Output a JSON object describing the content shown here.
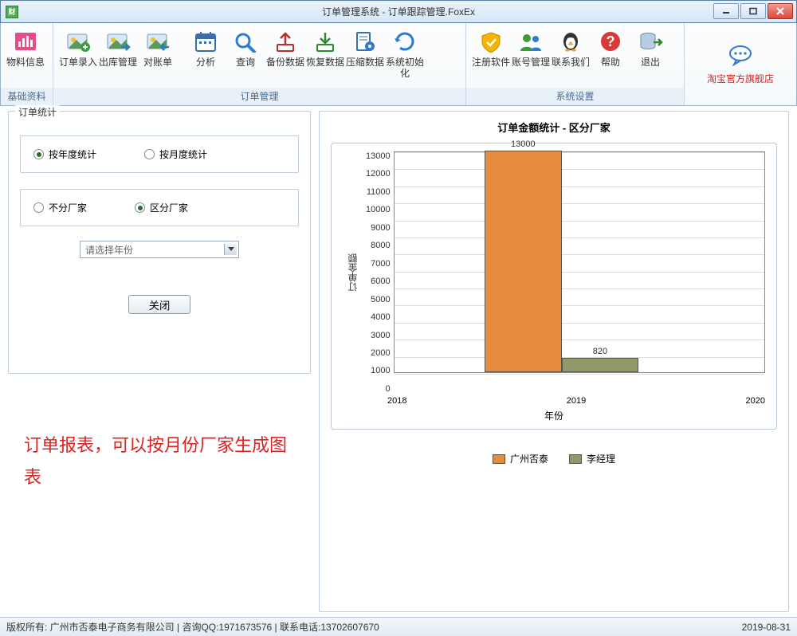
{
  "window": {
    "title": "订单管理系统 - 订单跟踪管理.FoxEx"
  },
  "ribbon": {
    "groups": [
      {
        "label": "基础资料",
        "items": [
          {
            "name": "material-info",
            "label": "物料信息",
            "icon": "chart-pink"
          },
          {
            "name": "order-entry",
            "label": "订单录入",
            "icon": "photo-plus"
          },
          {
            "name": "outbound-mgmt",
            "label": "出库管理",
            "icon": "photo-right"
          },
          {
            "name": "reconcile",
            "label": "对账单",
            "icon": "photo-left"
          }
        ]
      },
      {
        "label": "订单管理",
        "items": [
          {
            "name": "analysis",
            "label": "分析",
            "icon": "calendar"
          },
          {
            "name": "query",
            "label": "查询",
            "icon": "magnifier"
          },
          {
            "name": "backup",
            "label": "备份数据",
            "icon": "upload"
          },
          {
            "name": "restore",
            "label": "恢复数据",
            "icon": "download"
          },
          {
            "name": "compress",
            "label": "压缩数据",
            "icon": "doc-gear"
          },
          {
            "name": "init",
            "label": "系统初始化",
            "icon": "refresh"
          }
        ]
      },
      {
        "label": "系统设置",
        "items": [
          {
            "name": "register",
            "label": "注册软件",
            "icon": "shield"
          },
          {
            "name": "accounts",
            "label": "账号管理",
            "icon": "users"
          },
          {
            "name": "contact",
            "label": "联系我们",
            "icon": "qq"
          },
          {
            "name": "help",
            "label": "帮助",
            "icon": "help"
          },
          {
            "name": "exit",
            "label": "退出",
            "icon": "db-exit"
          }
        ]
      }
    ],
    "shop": {
      "label": "淘宝官方旗舰店",
      "icon": "chat"
    }
  },
  "left": {
    "legend": "订单统计",
    "row1": {
      "a": "按年度统计",
      "b": "按月度统计",
      "selected": "a"
    },
    "row2": {
      "a": "不分厂家",
      "b": "区分厂家",
      "selected": "b"
    },
    "select_placeholder": "请选择年份",
    "close_btn": "关闭",
    "annotation": "订单报表，可以按月份厂家生成图表"
  },
  "chart_data": {
    "type": "bar",
    "title": "订单金额统计 - 区分厂家",
    "xlabel": "年份",
    "ylabel": "订单金额",
    "x_ticks": [
      "2018",
      "2019",
      "2020"
    ],
    "y_ticks": [
      0,
      1000,
      2000,
      3000,
      4000,
      5000,
      6000,
      7000,
      8000,
      9000,
      10000,
      11000,
      12000,
      13000
    ],
    "ylim": [
      0,
      13000
    ],
    "series": [
      {
        "name": "广州否泰",
        "color": "#e78b3e",
        "points": [
          {
            "x": "2019",
            "value": 13000
          }
        ]
      },
      {
        "name": "李经理",
        "color": "#90996a",
        "points": [
          {
            "x": "2019",
            "value": 820
          }
        ]
      }
    ]
  },
  "status": {
    "left": "版权所有: 广州市否泰电子商务有限公司 | 咨询QQ:1971673576 | 联系电话:13702607670",
    "right": "2019-08-31"
  }
}
